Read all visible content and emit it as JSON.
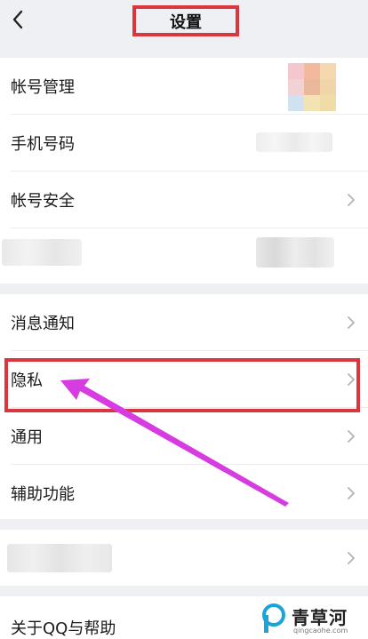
{
  "header": {
    "title": "设置"
  },
  "account_group": {
    "items": [
      {
        "label": "帐号管理"
      },
      {
        "label": "手机号码"
      },
      {
        "label": "帐号安全"
      }
    ]
  },
  "notify_group": {
    "items": [
      {
        "label": "消息通知"
      },
      {
        "label": "隐私"
      },
      {
        "label": "通用"
      },
      {
        "label": "辅助功能"
      }
    ]
  },
  "about": {
    "label": "关于QQ与帮助"
  },
  "colors": {
    "highlight": "#d9363e",
    "arrow": "#d63ce0",
    "background": "#eef0f4"
  },
  "watermark": {
    "name": "青草河",
    "domain": "qingcaohe.com"
  }
}
